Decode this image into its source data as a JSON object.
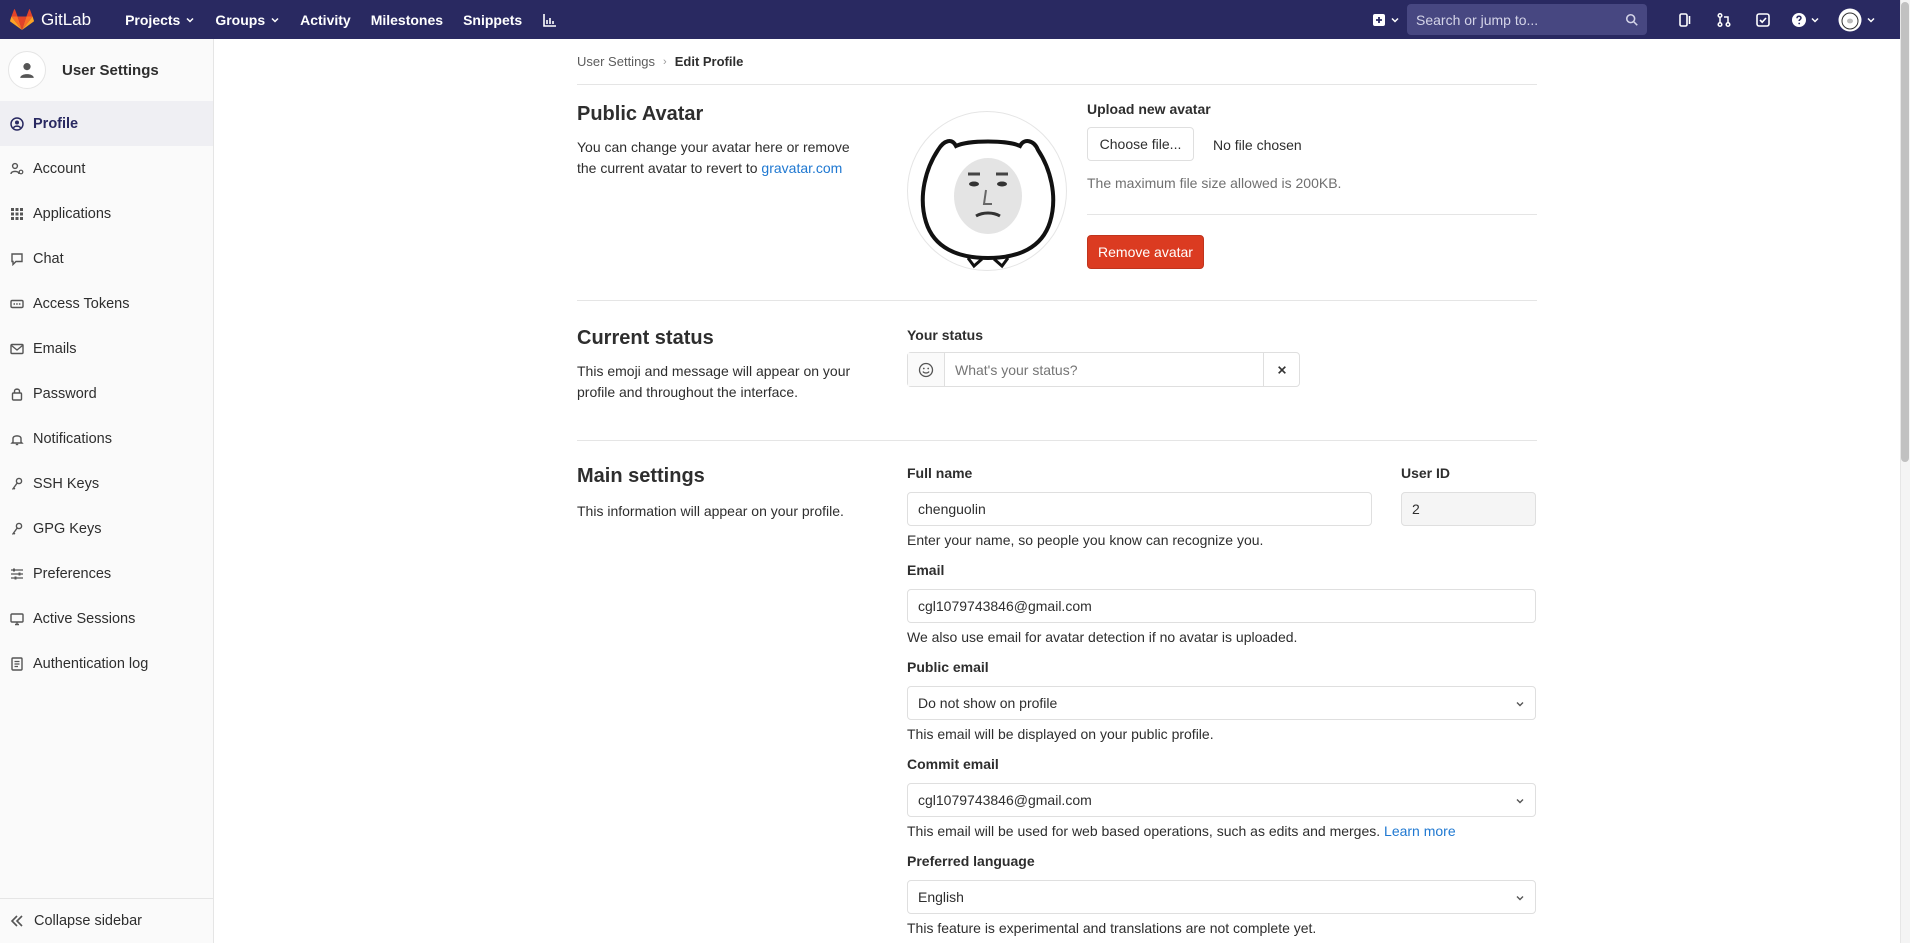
{
  "navbar": {
    "brand": "GitLab",
    "links": [
      {
        "label": "Projects",
        "has_caret": true
      },
      {
        "label": "Groups",
        "has_caret": true
      },
      {
        "label": "Activity",
        "has_caret": false
      },
      {
        "label": "Milestones",
        "has_caret": false
      },
      {
        "label": "Snippets",
        "has_caret": false
      }
    ],
    "search_placeholder": "Search or jump to..."
  },
  "sidebar": {
    "title": "User Settings",
    "items": [
      {
        "label": "Profile",
        "icon": "profile-icon",
        "active": true
      },
      {
        "label": "Account",
        "icon": "account-icon",
        "active": false
      },
      {
        "label": "Applications",
        "icon": "applications-icon",
        "active": false
      },
      {
        "label": "Chat",
        "icon": "chat-icon",
        "active": false
      },
      {
        "label": "Access Tokens",
        "icon": "token-icon",
        "active": false
      },
      {
        "label": "Emails",
        "icon": "email-icon",
        "active": false
      },
      {
        "label": "Password",
        "icon": "lock-icon",
        "active": false
      },
      {
        "label": "Notifications",
        "icon": "bell-icon",
        "active": false
      },
      {
        "label": "SSH Keys",
        "icon": "key-icon",
        "active": false
      },
      {
        "label": "GPG Keys",
        "icon": "key-icon",
        "active": false
      },
      {
        "label": "Preferences",
        "icon": "preferences-icon",
        "active": false
      },
      {
        "label": "Active Sessions",
        "icon": "monitor-icon",
        "active": false
      },
      {
        "label": "Authentication log",
        "icon": "log-icon",
        "active": false
      }
    ],
    "collapse_label": "Collapse sidebar"
  },
  "breadcrumb": {
    "parent": "User Settings",
    "current": "Edit Profile"
  },
  "public_avatar": {
    "title": "Public Avatar",
    "desc_text": "You can change your avatar here or remove the current avatar to revert to ",
    "desc_link": "gravatar.com",
    "upload_label": "Upload new avatar",
    "choose_button": "Choose file...",
    "no_file": "No file chosen",
    "size_help": "The maximum file size allowed is 200KB.",
    "remove_button": "Remove avatar"
  },
  "current_status": {
    "title": "Current status",
    "desc": "This emoji and message will appear on your profile and throughout the interface.",
    "label": "Your status",
    "placeholder": "What's your status?"
  },
  "main_settings": {
    "title": "Main settings",
    "desc": "This information will appear on your profile.",
    "full_name_label": "Full name",
    "full_name_value": "chenguolin",
    "full_name_help": "Enter your name, so people you know can recognize you.",
    "user_id_label": "User ID",
    "user_id_value": "2",
    "email_label": "Email",
    "email_value": "cgl1079743846@gmail.com",
    "email_help": "We also use email for avatar detection if no avatar is uploaded.",
    "public_email_label": "Public email",
    "public_email_value": "Do not show on profile",
    "public_email_help": "This email will be displayed on your public profile.",
    "commit_email_label": "Commit email",
    "commit_email_value": "cgl1079743846@gmail.com",
    "commit_email_help": "This email will be used for web based operations, such as edits and merges.",
    "commit_email_link": "Learn more",
    "language_label": "Preferred language",
    "language_value": "English",
    "language_help": "This feature is experimental and translations are not complete yet."
  },
  "colors": {
    "navbar": "#292961",
    "link": "#1f78d1",
    "danger": "#db3b21"
  }
}
